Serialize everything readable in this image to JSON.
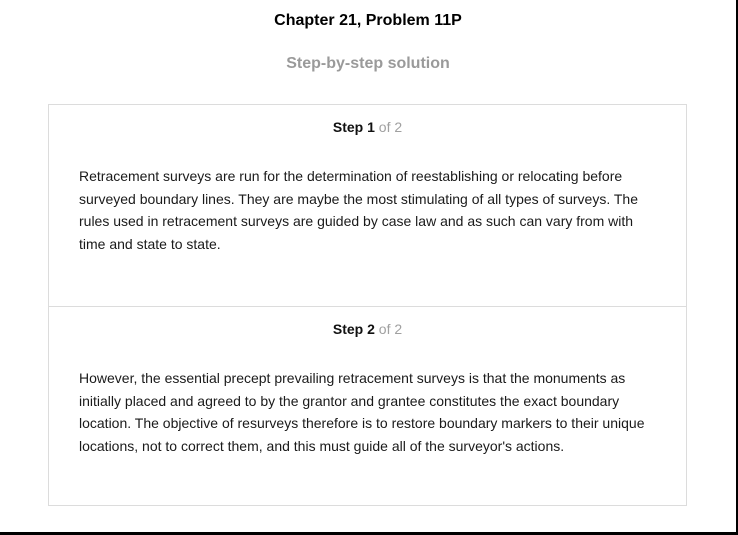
{
  "page": {
    "title": "Chapter 21, Problem 11P",
    "subtitle": "Step-by-step solution"
  },
  "steps": [
    {
      "word": "Step",
      "number": "1",
      "of_total": "of 2",
      "text": "Retracement surveys are run for the determination of reestablishing or relocating before surveyed boundary lines. They are maybe the most stimulating of all types of surveys. The rules used in retracement surveys are guided by case law and as such can vary from with time and state to state."
    },
    {
      "word": "Step",
      "number": "2",
      "of_total": "of 2",
      "text": "However, the essential precept prevailing retracement surveys is that the monuments as initially placed and agreed to by the grantor and grantee constitutes the exact boundary location. The objective of resurveys therefore is to restore boundary markers to their unique locations, not to correct them, and this must guide all of the surveyor's actions."
    }
  ]
}
